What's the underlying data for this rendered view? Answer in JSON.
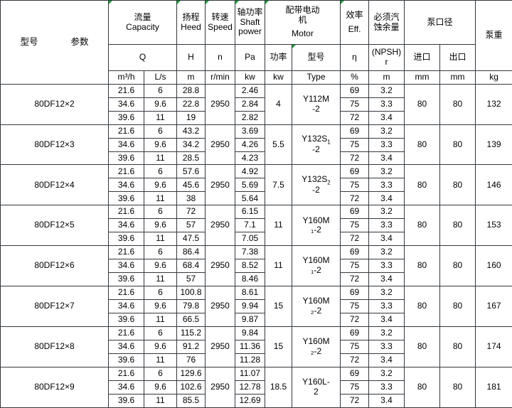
{
  "table": {
    "corner": {
      "model_label": "型号",
      "param_label": "参数"
    },
    "groups": [
      {
        "cn": "流量",
        "en": "Capacity",
        "symbol": "Q",
        "units": [
          "m³/h",
          "L/s"
        ]
      },
      {
        "cn": "扬程",
        "en": "Heed",
        "symbol": "H",
        "units": [
          "m"
        ]
      },
      {
        "cn": "转速",
        "en": "Speed",
        "symbol": "n",
        "units": [
          "r/min"
        ]
      },
      {
        "cn": "轴功率",
        "en": "Shaft power",
        "symbol": "Pa",
        "units": [
          "kw"
        ]
      },
      {
        "cn": "配带电动机",
        "en": "Motor",
        "symbol": "功率",
        "symbol2": "型号",
        "units": [
          "kw",
          "Type"
        ]
      },
      {
        "cn": "效率",
        "en": "Eff.",
        "symbol": "η",
        "units": [
          "%"
        ]
      },
      {
        "cn": "必须汽蚀余量",
        "en": "",
        "symbol": "(NPSH)r",
        "units": [
          "m"
        ]
      },
      {
        "cn": "泵口径",
        "en": "",
        "symbol": "进口",
        "symbol2": "出口",
        "units": [
          "mm",
          "mm"
        ]
      },
      {
        "cn": "泵重",
        "en": "",
        "symbol": "",
        "units": [
          "kg"
        ]
      }
    ],
    "headers": {
      "capacity_cn": "流量",
      "capacity_en": "Capacity",
      "head_cn": "扬程",
      "head_en": "Heed",
      "speed_cn": "转速",
      "speed_en": "Speed",
      "shaft_cn": "轴功率",
      "shaft_en": "Shaft",
      "shaft_en2": "power",
      "motor_cn": "配带电动机",
      "motor_cn_line1": "配带电动",
      "motor_cn_line2": "机",
      "motor_en": "Motor",
      "eff_cn": "效率",
      "eff_en": "Eff.",
      "npsh_cn_line1": "必须汽",
      "npsh_cn_line2": "蚀余量",
      "bore_cn": "泵口径",
      "weight_cn": "泵重",
      "sym_q": "Q",
      "sym_h": "H",
      "sym_n": "n",
      "sym_pa": "Pa",
      "sym_motor_power": "功率",
      "sym_motor_type": "型号",
      "sym_eta": "η",
      "sym_npsh_line1": "(NPSH)",
      "sym_npsh_line2": "r",
      "sym_inlet": "进口",
      "sym_outlet": "出口",
      "unit_m3h": "m³/h",
      "unit_ls": "L/s",
      "unit_m": "m",
      "unit_rmin": "r/min",
      "unit_kw": "kw",
      "unit_kw2": "kw",
      "unit_type": "Type",
      "unit_percent": "%",
      "unit_m_npsh": "m",
      "unit_mm_in": "mm",
      "unit_mm_out": "mm",
      "unit_kg": "kg"
    },
    "rows": [
      {
        "model": "80DF12×2",
        "speed": "2950",
        "motor_power": "4",
        "motor_type_line1": "Y112M",
        "motor_type_sub": "",
        "motor_type_line2": "-2",
        "inlet": "80",
        "outlet": "80",
        "weight": "132",
        "points": [
          {
            "q_m3h": "21.6",
            "q_ls": "6",
            "head": "28.8",
            "shaft": "2.46",
            "eff": "69",
            "npsh": "3.2"
          },
          {
            "q_m3h": "34.6",
            "q_ls": "9.6",
            "head": "22.8",
            "shaft": "2.84",
            "eff": "75",
            "npsh": "3.3"
          },
          {
            "q_m3h": "39.6",
            "q_ls": "11",
            "head": "19",
            "shaft": "2.82",
            "eff": "72",
            "npsh": "3.4"
          }
        ]
      },
      {
        "model": "80DF12×3",
        "speed": "2950",
        "motor_power": "5.5",
        "motor_type_line1": "Y132S",
        "motor_type_sub": "1",
        "motor_type_line2": "-2",
        "inlet": "80",
        "outlet": "80",
        "weight": "139",
        "points": [
          {
            "q_m3h": "21.6",
            "q_ls": "6",
            "head": "43.2",
            "shaft": "3.69",
            "eff": "69",
            "npsh": "3.2"
          },
          {
            "q_m3h": "34.6",
            "q_ls": "9.6",
            "head": "34.2",
            "shaft": "4.26",
            "eff": "75",
            "npsh": "3.3"
          },
          {
            "q_m3h": "39.6",
            "q_ls": "11",
            "head": "28.5",
            "shaft": "4.23",
            "eff": "72",
            "npsh": "3.4"
          }
        ]
      },
      {
        "model": "80DF12×4",
        "speed": "2950",
        "motor_power": "7.5",
        "motor_type_line1": "Y132S",
        "motor_type_sub": "2",
        "motor_type_line2": "-2",
        "inlet": "80",
        "outlet": "80",
        "weight": "146",
        "points": [
          {
            "q_m3h": "21.6",
            "q_ls": "6",
            "head": "57.6",
            "shaft": "4.92",
            "eff": "69",
            "npsh": "3.2"
          },
          {
            "q_m3h": "34.6",
            "q_ls": "9.6",
            "head": "45.6",
            "shaft": "5.69",
            "eff": "75",
            "npsh": "3.3"
          },
          {
            "q_m3h": "39.6",
            "q_ls": "11",
            "head": "38",
            "shaft": "5.64",
            "eff": "72",
            "npsh": "3.4"
          }
        ]
      },
      {
        "model": "80DF12×5",
        "speed": "2950",
        "motor_power": "11",
        "motor_type_line1": "Y160M",
        "motor_type_sub": "",
        "motor_type_line2": "₁-2",
        "inlet": "80",
        "outlet": "80",
        "weight": "153",
        "points": [
          {
            "q_m3h": "21.6",
            "q_ls": "6",
            "head": "72",
            "shaft": "6.15",
            "eff": "69",
            "npsh": "3.2"
          },
          {
            "q_m3h": "34.6",
            "q_ls": "9.6",
            "head": "57",
            "shaft": "7.1",
            "eff": "75",
            "npsh": "3.3"
          },
          {
            "q_m3h": "39.6",
            "q_ls": "11",
            "head": "47.5",
            "shaft": "7.05",
            "eff": "72",
            "npsh": "3.4"
          }
        ]
      },
      {
        "model": "80DF12×6",
        "speed": "2950",
        "motor_power": "11",
        "motor_type_line1": "Y160M",
        "motor_type_sub": "",
        "motor_type_line2": "₁-2",
        "inlet": "80",
        "outlet": "80",
        "weight": "160",
        "points": [
          {
            "q_m3h": "21.6",
            "q_ls": "6",
            "head": "86.4",
            "shaft": "7.38",
            "eff": "69",
            "npsh": "3.2"
          },
          {
            "q_m3h": "34.6",
            "q_ls": "9.6",
            "head": "68.4",
            "shaft": "8.52",
            "eff": "75",
            "npsh": "3.3"
          },
          {
            "q_m3h": "39.6",
            "q_ls": "11",
            "head": "57",
            "shaft": "8.46",
            "eff": "72",
            "npsh": "3.4"
          }
        ]
      },
      {
        "model": "80DF12×7",
        "speed": "2950",
        "motor_power": "15",
        "motor_type_line1": "Y160M",
        "motor_type_sub": "",
        "motor_type_line2": "₂-2",
        "inlet": "80",
        "outlet": "80",
        "weight": "167",
        "points": [
          {
            "q_m3h": "21.6",
            "q_ls": "6",
            "head": "100.8",
            "shaft": "8.61",
            "eff": "69",
            "npsh": "3.2"
          },
          {
            "q_m3h": "34.6",
            "q_ls": "9.6",
            "head": "79.8",
            "shaft": "9.94",
            "eff": "75",
            "npsh": "3.3"
          },
          {
            "q_m3h": "39.6",
            "q_ls": "11",
            "head": "66.5",
            "shaft": "9.87",
            "eff": "72",
            "npsh": "3.4"
          }
        ]
      },
      {
        "model": "80DF12×8",
        "speed": "2950",
        "motor_power": "15",
        "motor_type_line1": "Y160M",
        "motor_type_sub": "",
        "motor_type_line2": "₂-2",
        "inlet": "80",
        "outlet": "80",
        "weight": "174",
        "points": [
          {
            "q_m3h": "21.6",
            "q_ls": "6",
            "head": "115.2",
            "shaft": "9.84",
            "eff": "69",
            "npsh": "3.2"
          },
          {
            "q_m3h": "34.6",
            "q_ls": "9.6",
            "head": "91.2",
            "shaft": "11.36",
            "eff": "75",
            "npsh": "3.3"
          },
          {
            "q_m3h": "39.6",
            "q_ls": "11",
            "head": "76",
            "shaft": "11.28",
            "eff": "72",
            "npsh": "3.4"
          }
        ]
      },
      {
        "model": "80DF12×9",
        "speed": "2950",
        "motor_power": "18.5",
        "motor_type_line1": "Y160L-",
        "motor_type_sub": "",
        "motor_type_line2": "2",
        "inlet": "80",
        "outlet": "80",
        "weight": "181",
        "points": [
          {
            "q_m3h": "21.6",
            "q_ls": "6",
            "head": "129.6",
            "shaft": "11.07",
            "eff": "69",
            "npsh": "3.2"
          },
          {
            "q_m3h": "34.6",
            "q_ls": "9.6",
            "head": "102.6",
            "shaft": "12.78",
            "eff": "75",
            "npsh": "3.3"
          },
          {
            "q_m3h": "39.6",
            "q_ls": "11",
            "head": "85.5",
            "shaft": "12.69",
            "eff": "72",
            "npsh": "3.4"
          }
        ]
      }
    ]
  },
  "colors": {
    "header_bg": "#9BCDFF",
    "border": "#33383f",
    "marker_green": "#1f9f3d",
    "text": "#000000"
  }
}
